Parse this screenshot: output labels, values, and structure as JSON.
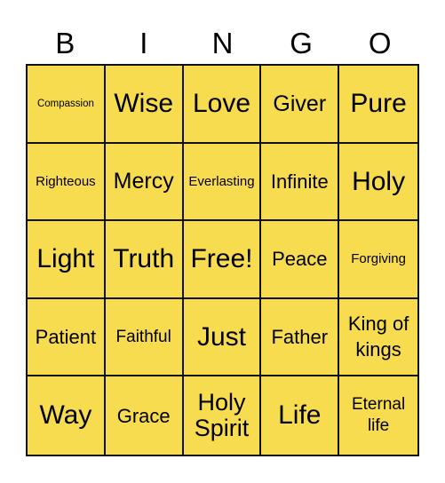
{
  "card": {
    "header": [
      "B",
      "I",
      "N",
      "G",
      "O"
    ],
    "fill_color": "#f8dc50",
    "border_color": "#111111",
    "rows": [
      [
        "Compassion",
        "Wise",
        "Love",
        "Giver",
        "Pure"
      ],
      [
        "Righteous",
        "Mercy",
        "Everlasting",
        "Infinite",
        "Holy"
      ],
      [
        "Light",
        "Truth",
        "Free!",
        "Peace",
        "Forgiving"
      ],
      [
        "Patient",
        "Faithful",
        "Just",
        "Father",
        "King of kings"
      ],
      [
        "Way",
        "Grace",
        "Holy Spirit",
        "Life",
        "Eternal life"
      ]
    ]
  }
}
